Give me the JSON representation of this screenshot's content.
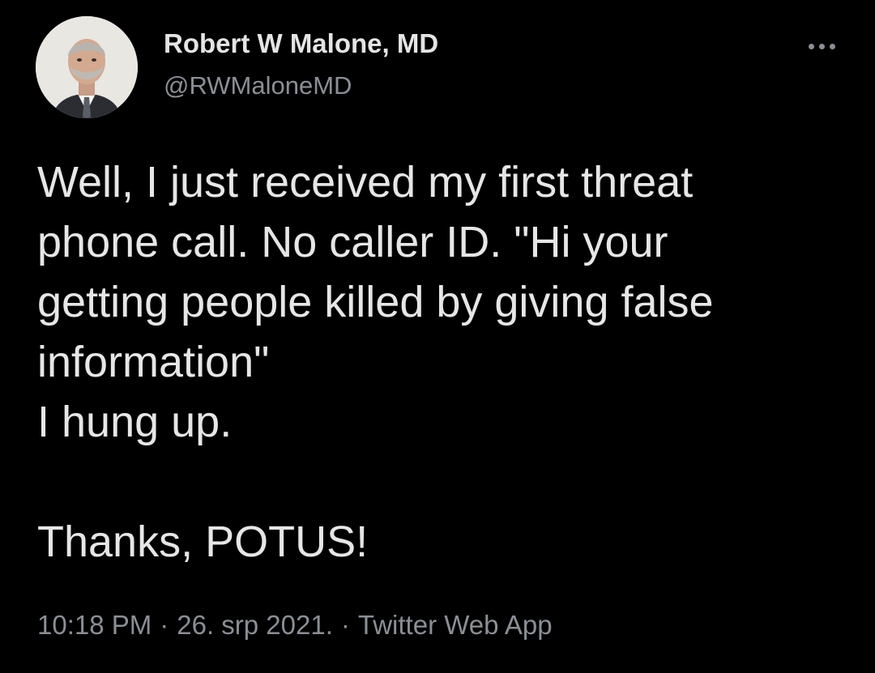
{
  "author": {
    "display_name": "Robert W Malone, MD",
    "handle": "@RWMaloneMD",
    "avatar_icon": "profile-photo"
  },
  "more_icon": "more-horizontal-icon",
  "tweet": {
    "lines": [
      "Well, I just received my first threat",
      "phone call.  No caller ID.  \"Hi your",
      "getting people killed by giving false",
      "information\"",
      "I hung up.",
      "",
      "Thanks, POTUS!"
    ]
  },
  "meta": {
    "time": "10:18 PM",
    "separator": "·",
    "date": "26. srp 2021.",
    "source": "Twitter Web App"
  },
  "colors": {
    "background": "#000000",
    "primary_text": "#e6e6e6",
    "secondary_text": "#8b8f94"
  }
}
